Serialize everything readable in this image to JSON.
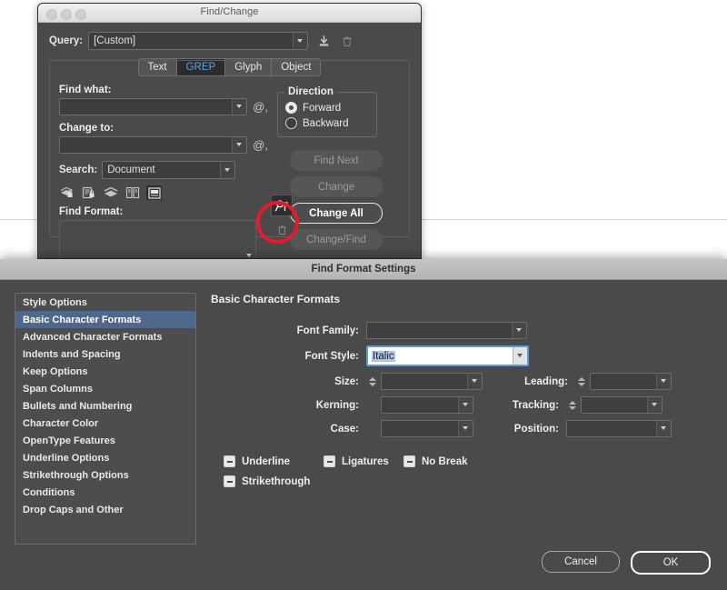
{
  "canvas": {
    "guide_color": "#8ff1ee"
  },
  "find_change": {
    "title": "Find/Change",
    "window_controls": [
      "close",
      "minimize",
      "maximize"
    ],
    "query": {
      "label": "Query:",
      "value": "[Custom]",
      "save_icon": "save-query-icon",
      "delete_icon": "trash-icon"
    },
    "tabs": [
      {
        "label": "Text",
        "active": false
      },
      {
        "label": "GREP",
        "active": true
      },
      {
        "label": "Glyph",
        "active": false
      },
      {
        "label": "Object",
        "active": false
      }
    ],
    "find_what": {
      "label": "Find what:",
      "value": "",
      "special_chars_icon": "at-menu-icon"
    },
    "change_to": {
      "label": "Change to:",
      "value": "",
      "special_chars_icon": "at-menu-icon"
    },
    "search": {
      "label": "Search:",
      "value": "Document"
    },
    "scope_icons": [
      "include-locked-layers-icon",
      "include-locked-stories-icon",
      "include-hidden-layers-icon",
      "include-master-pages-icon",
      "include-footnotes-icon"
    ],
    "find_format": {
      "label": "Find Format:",
      "value": "",
      "specify_attributes_icon": "specify-attributes-to-find-icon",
      "clear_icon": "clear-format-trash-icon"
    },
    "direction": {
      "legend": "Direction",
      "options": [
        {
          "label": "Forward",
          "selected": true
        },
        {
          "label": "Backward",
          "selected": false
        }
      ]
    },
    "action_buttons": [
      {
        "label": "Find Next",
        "enabled": false
      },
      {
        "label": "Change",
        "enabled": false
      },
      {
        "label": "Change All",
        "enabled": true
      },
      {
        "label": "Change/Find",
        "enabled": false
      }
    ],
    "annotation": {
      "shape": "circle",
      "color": "#e8192c",
      "target": "specify-attributes-to-find-icon"
    }
  },
  "find_format_settings": {
    "title": "Find Format Settings",
    "sidebar": [
      {
        "label": "Style Options",
        "active": false
      },
      {
        "label": "Basic Character Formats",
        "active": true
      },
      {
        "label": "Advanced Character Formats",
        "active": false
      },
      {
        "label": "Indents and Spacing",
        "active": false
      },
      {
        "label": "Keep Options",
        "active": false
      },
      {
        "label": "Span Columns",
        "active": false
      },
      {
        "label": "Bullets and Numbering",
        "active": false
      },
      {
        "label": "Character Color",
        "active": false
      },
      {
        "label": "OpenType Features",
        "active": false
      },
      {
        "label": "Underline Options",
        "active": false
      },
      {
        "label": "Strikethrough Options",
        "active": false
      },
      {
        "label": "Conditions",
        "active": false
      },
      {
        "label": "Drop Caps and Other",
        "active": false
      }
    ],
    "section_title": "Basic Character Formats",
    "fields": {
      "font_family": {
        "label": "Font Family:",
        "value": ""
      },
      "font_style": {
        "label": "Font Style:",
        "value": "Italic",
        "focused": true,
        "text_selected": true
      },
      "size": {
        "label": "Size:",
        "value": "",
        "has_stepper": true
      },
      "leading": {
        "label": "Leading:",
        "value": "",
        "has_stepper": true
      },
      "kerning": {
        "label": "Kerning:",
        "value": "",
        "has_stepper": false
      },
      "tracking": {
        "label": "Tracking:",
        "value": "",
        "has_stepper": true
      },
      "case": {
        "label": "Case:",
        "value": "",
        "has_stepper": false
      },
      "position": {
        "label": "Position:",
        "value": "",
        "has_stepper": false
      }
    },
    "checkboxes": [
      {
        "label": "Underline",
        "state": "mixed"
      },
      {
        "label": "Ligatures",
        "state": "mixed"
      },
      {
        "label": "No Break",
        "state": "mixed"
      },
      {
        "label": "Strikethrough",
        "state": "mixed"
      }
    ],
    "footer_buttons": [
      {
        "label": "Cancel",
        "default": false
      },
      {
        "label": "OK",
        "default": true
      }
    ],
    "selection_highlight_color": "#aec4e8",
    "active_row_color": "#4e688c"
  }
}
